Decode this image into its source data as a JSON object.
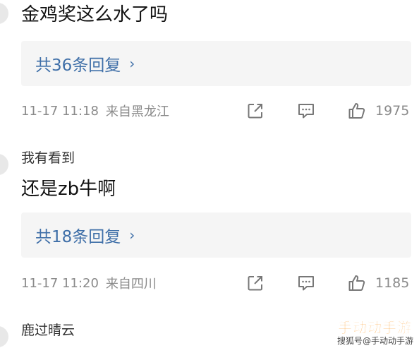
{
  "comments": [
    {
      "text": "金鸡奖这么水了吗",
      "reply_label": "共36条回复",
      "time": "11-17 11:18",
      "location": "来自黑龙江",
      "likes": "1975"
    },
    {
      "username": "我有看到",
      "text": "还是zb牛啊",
      "reply_label": "共18条回复",
      "time": "11-17 11:20",
      "location": "来自四川",
      "likes": "1185"
    },
    {
      "username": "鹿过晴云"
    }
  ],
  "icons": {
    "reply_arrow": "chevron-right-icon",
    "share": "share-icon",
    "comment": "comment-icon",
    "like": "thumbs-up-icon"
  },
  "watermark": {
    "brand": "手动动手游",
    "sub": "搜狐号@手动动手游"
  },
  "colors": {
    "link_blue": "#3f6fa8",
    "meta_gray": "#8a8a8a",
    "reply_bg": "#f5f5f5",
    "watermark_orange": "#ff8a00"
  }
}
